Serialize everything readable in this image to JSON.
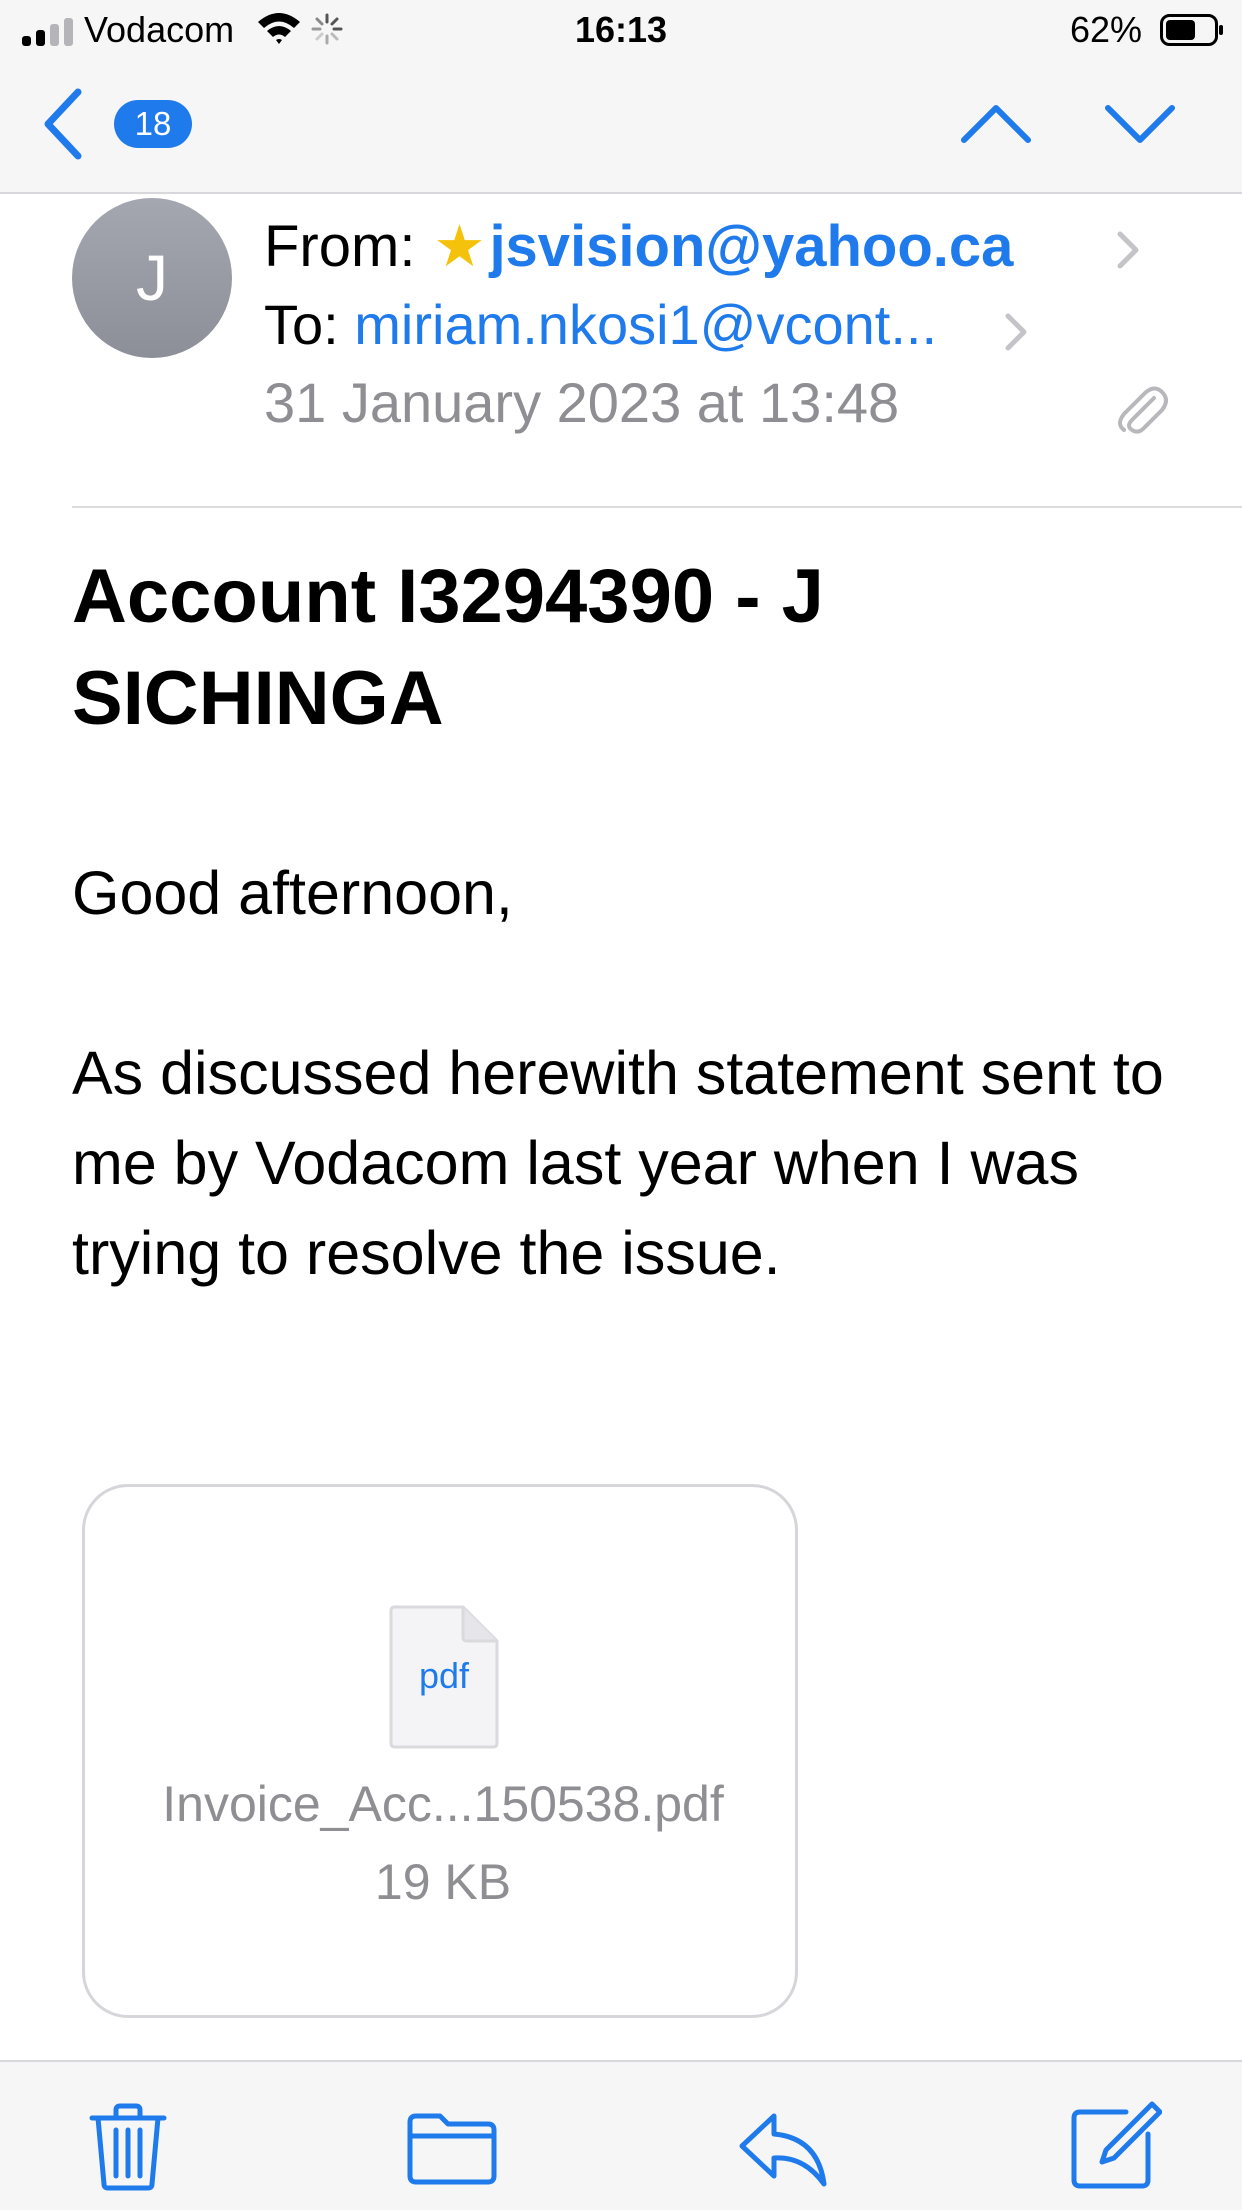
{
  "status_bar": {
    "carrier": "Vodacom",
    "time": "16:13",
    "battery_percent": "62%",
    "battery_level": 0.62,
    "signal_bars_filled": 2,
    "signal_bars_total": 4
  },
  "nav": {
    "unread_count": "18",
    "accent_color": "#1f7aeb"
  },
  "header": {
    "avatar_initial": "J",
    "from_label": "From:",
    "from_star": "★",
    "from_address": "jsvision@yahoo.ca",
    "to_label": "To:",
    "to_address": "miriam.nkosi1@vcont...",
    "date": "31 January 2023 at 13:48",
    "has_attachment_icon": "paperclip-icon"
  },
  "email": {
    "subject": "Account I3294390 - J SICHINGA",
    "greeting": "Good afternoon,",
    "body": "As discussed herewith statement sent to me by Vodacom last year when I was trying to resolve the issue."
  },
  "attachment": {
    "icon_label": "pdf",
    "file_name": "Invoice_Acc...150538.pdf",
    "file_size": "19 KB"
  },
  "toolbar": {
    "icons": [
      "trash-icon",
      "folder-icon",
      "reply-icon",
      "compose-icon"
    ]
  }
}
